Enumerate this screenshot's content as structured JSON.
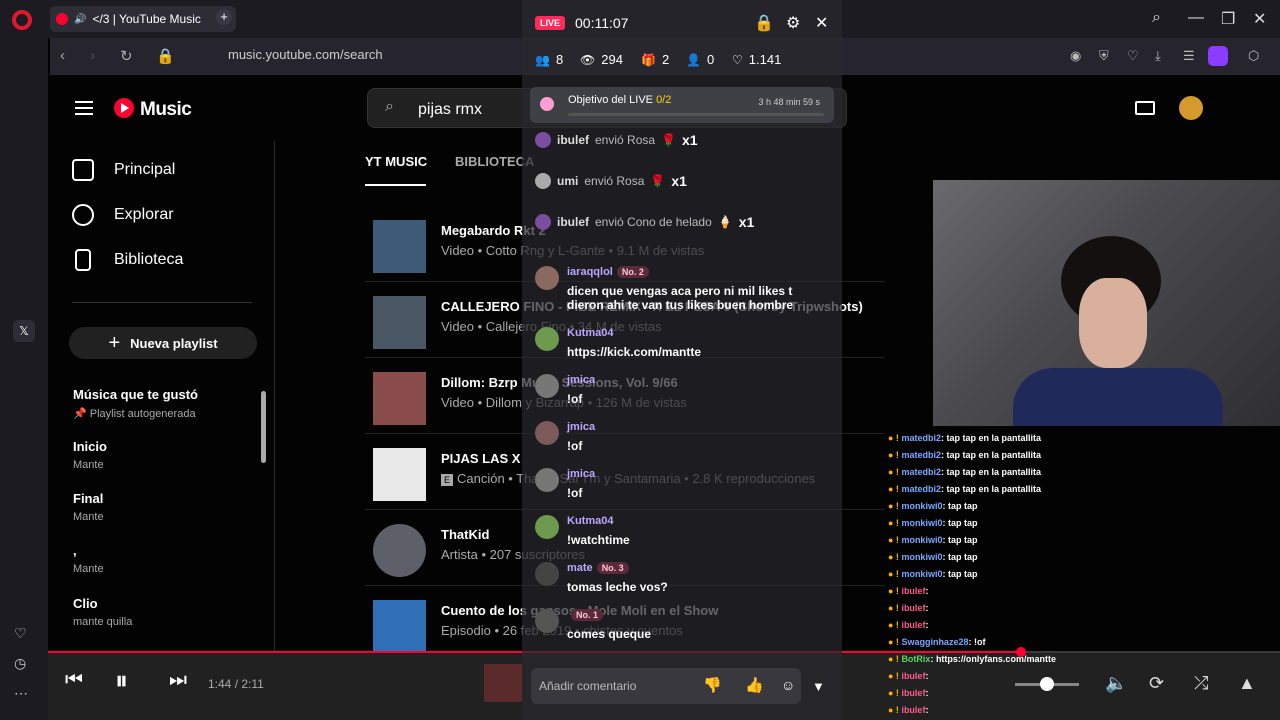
{
  "browser": {
    "tab_title": "</3 | YouTube Music",
    "url": "music.youtube.com/search",
    "left_rail_icon": "x-icon"
  },
  "ytm": {
    "brand": "Music",
    "search_value": "pijas rmx",
    "tabs": [
      "YT MUSIC",
      "BIBLIOTECA"
    ],
    "nav": [
      "Principal",
      "Explorar",
      "Biblioteca"
    ],
    "new_playlist": "Nueva playlist",
    "playlists": [
      {
        "title": "Música que te gustó",
        "sub": "Playlist autogenerada"
      },
      {
        "title": "Inicio",
        "sub": "Mante"
      },
      {
        "title": "Final",
        "sub": "Mante"
      },
      {
        "title": ",",
        "sub": "Mante"
      },
      {
        "title": "Clio",
        "sub": "mante quilla"
      }
    ],
    "results": [
      {
        "title": "Megabardo Rkt 2",
        "sub": "Video • Cotto Rng y L-Gante • 9.1 M de vistas"
      },
      {
        "title": "CALLEJERO FINO - PIBE REMIX - X EL PESA 9 (Shot by Tripwshots)",
        "sub": "Video • Callejero Fino • 34 M de vistas"
      },
      {
        "title": "Dillom: Bzrp Music Sessions, Vol. 9/66",
        "sub": "Video • Dillom y Bizarrap • 126 M de vistas"
      },
      {
        "title": "PIJAS LAS X",
        "sub": "Canción • Thaku, Sar I'm y Santamaria • 2.8 K reproducciones"
      },
      {
        "title": "ThatKid",
        "sub": "Artista • 207 suscriptores"
      },
      {
        "title": "Cuento de los gansos - Mole Moli en el Show",
        "sub": "Episodio • 26 feb 2019 • chistes y cuentos"
      }
    ],
    "player": {
      "time": "1:44 / 2:11",
      "progress": 0.79,
      "volume": 0.5
    }
  },
  "live": {
    "badge": "LIVE",
    "timer": "00:11:07",
    "stats": [
      "8",
      "294",
      "2",
      "0",
      "1.141"
    ],
    "goal_label": "Objetivo del LIVE",
    "goal_count": "0/2",
    "goal_time": "3 h 48 min 59 s",
    "gifts": [
      {
        "user": "ibulef",
        "action": "envió Rosa",
        "count": "x1"
      },
      {
        "user": "umi",
        "action": "envió Rosa",
        "count": "x1"
      },
      {
        "user": "ibulef",
        "action": "envió Cono de helado",
        "count": "x1"
      }
    ],
    "messages": [
      {
        "user": "iaraqqlol",
        "badge": "No. 2",
        "text": "dicen que vengas aca pero ni mil likes t dieron ahi te van tus likes buen hombre"
      },
      {
        "user": "Kutma04",
        "badge": "",
        "text": "https://kick.com/mantte"
      },
      {
        "user": "jmica",
        "badge": "",
        "text": "!of"
      },
      {
        "user": "jmica",
        "badge": "",
        "text": "!of"
      },
      {
        "user": "jmica",
        "badge": "",
        "text": "!of"
      },
      {
        "user": "Kutma04",
        "badge": "",
        "text": "!watchtime"
      },
      {
        "user": "mate",
        "badge": "No. 3",
        "text": "tomas leche vos?"
      },
      {
        "user": "",
        "badge": "No. 1",
        "text": "comes queque"
      }
    ],
    "comment_placeholder": "Añadir comentario"
  },
  "twitch": {
    "lines": [
      {
        "user": "matedbi2",
        "text": "tap tap en la pantallita"
      },
      {
        "user": "matedbi2",
        "text": "tap tap en la pantallita"
      },
      {
        "user": "matedbi2",
        "text": "tap tap en la pantallita"
      },
      {
        "user": "matedbi2",
        "text": "tap tap en la pantallita"
      },
      {
        "user": "monkiwi0",
        "text": "tap tap"
      },
      {
        "user": "monkiwi0",
        "text": "tap tap"
      },
      {
        "user": "monkiwi0",
        "text": "tap tap"
      },
      {
        "user": "monkiwi0",
        "text": "tap tap"
      },
      {
        "user": "monkiwi0",
        "text": "tap tap"
      },
      {
        "user": "ibulef",
        "text": ""
      },
      {
        "user": "ibulef",
        "text": ""
      },
      {
        "user": "ibulef",
        "text": ""
      },
      {
        "user": "Swagginhaze28",
        "text": "!of"
      },
      {
        "user": "BotRix",
        "text": "https://onlyfans.com/mantte"
      },
      {
        "user": "ibulef",
        "text": ""
      },
      {
        "user": "ibulef",
        "text": ""
      },
      {
        "user": "ibulef",
        "text": ""
      }
    ]
  }
}
